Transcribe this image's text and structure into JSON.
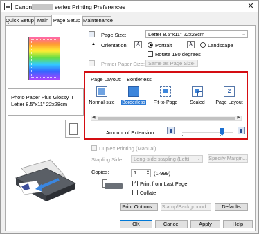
{
  "window": {
    "title_brand": "Canon",
    "title_rest": "series Printing Preferences",
    "close_glyph": "✕"
  },
  "tabs": [
    "Quick Setup",
    "Main",
    "Page Setup",
    "Maintenance"
  ],
  "active_tab": "Page Setup",
  "left_panel": {
    "media_line1": "Photo Paper Plus Glossy II",
    "media_line2": "Letter 8.5\"x11\" 22x28cm"
  },
  "page_size": {
    "label": "Page Size:",
    "value": "Letter 8.5\"x11\" 22x28cm"
  },
  "orientation": {
    "label": "Orientation:",
    "portrait": "Portrait",
    "landscape": "Landscape",
    "selected": "Portrait",
    "icon_glyph": "A",
    "rotate_label": "Rotate 180 degrees",
    "rotate_checked": false
  },
  "printer_paper_size": {
    "label": "Printer Paper Size:",
    "value": "Same as Page Size"
  },
  "page_layout": {
    "label": "Page Layout:",
    "current": "Borderless",
    "items": [
      "Normal-size",
      "Borderless",
      "Fit-to-Page",
      "Scaled",
      "Page Layout"
    ],
    "selected": "Borderless",
    "page_layout_icon_text": "2",
    "amount_label": "Amount of Extension:",
    "extension_level": 0.78
  },
  "duplex": {
    "label": "Duplex Printing (Manual)",
    "checked": false,
    "stapling_label": "Stapling Side:",
    "stapling_value": "Long-side stapling (Left)",
    "margin_button": "Specify Margin..."
  },
  "copies": {
    "label": "Copies:",
    "value": "1",
    "range": "(1-999)",
    "print_from_last": "Print from Last Page",
    "print_from_last_checked": true,
    "collate": "Collate",
    "collate_checked": false
  },
  "buttons": {
    "print_options": "Print Options...",
    "stamp": "Stamp/Background...",
    "defaults": "Defaults",
    "ok": "OK",
    "cancel": "Cancel",
    "apply": "Apply",
    "help": "Help"
  },
  "colors": {
    "highlight_border": "#d40d12",
    "selection_blue": "#2b7ad6",
    "slider_thumb": "#1b6fd1"
  },
  "icons": {
    "dropdown": "chevron-down-icon",
    "close": "close-icon",
    "printer": "printer-illustration"
  }
}
